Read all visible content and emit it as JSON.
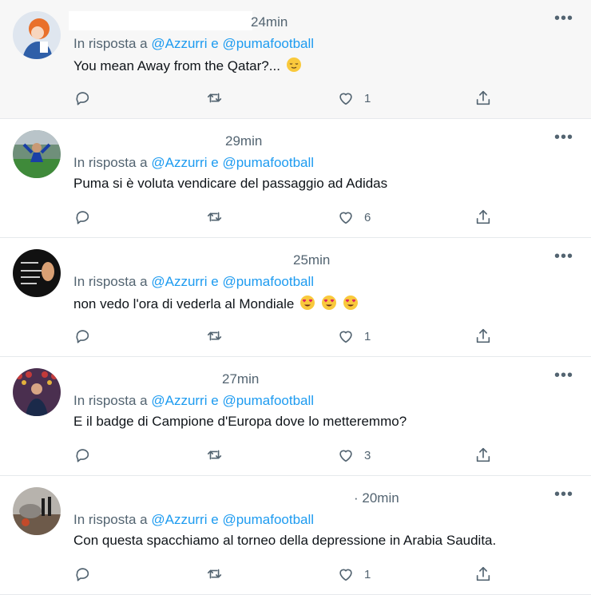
{
  "tweets": [
    {
      "time": "24min",
      "reply_prefix": "In risposta a",
      "h1": "@Azzurri",
      "conj": "e",
      "h2": "@pumafootball",
      "text": "You mean Away from the Qatar?...",
      "likes": "1"
    },
    {
      "time": "29min",
      "reply_prefix": "In risposta a",
      "h1": "@Azzurri",
      "conj": "e",
      "h2": "@pumafootball",
      "text": "Puma si è voluta vendicare del passaggio ad Adidas",
      "likes": "6"
    },
    {
      "time": "25min",
      "reply_prefix": "In risposta a",
      "h1": "@Azzurri",
      "conj": "e",
      "h2": "@pumafootball",
      "text": "non vedo l'ora di vederla al Mondiale",
      "likes": "1"
    },
    {
      "time": "27min",
      "reply_prefix": "In risposta a",
      "h1": "@Azzurri",
      "conj": "e",
      "h2": "@pumafootball",
      "text": "E il badge di Campione d'Europa dove lo metteremmo?",
      "likes": "3"
    },
    {
      "time": "· 20min",
      "reply_prefix": "In risposta a",
      "h1": "@Azzurri",
      "conj": "e",
      "h2": "@pumafootball",
      "text": "Con questa spacchiamo al torneo della depressione in Arabia Saudita.",
      "likes": "1"
    }
  ],
  "menu_glyph": "•••",
  "colors": {
    "link": "#1d9bf0",
    "muted": "#536471"
  }
}
